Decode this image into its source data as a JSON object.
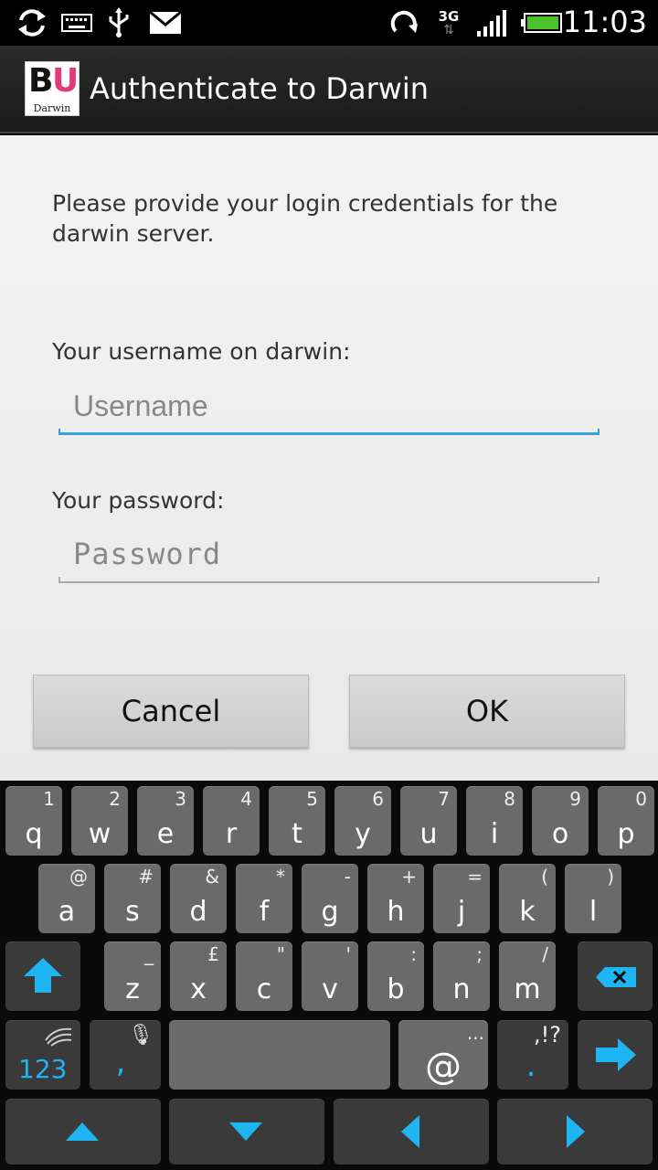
{
  "status_bar": {
    "time": "11:03",
    "network": "3G",
    "icons": [
      "sync-icon",
      "keyboard-icon",
      "usb-icon",
      "mail-icon",
      "refresh-icon",
      "network-3g-icon",
      "signal-icon",
      "battery-icon"
    ]
  },
  "action_bar": {
    "logo": {
      "letters_b": "B",
      "letters_u": "U",
      "caption": "Darwin"
    },
    "title": "Authenticate to Darwin"
  },
  "dialog": {
    "message": "Please provide your login credentials for the darwin server.",
    "username_label": "Your username on darwin:",
    "username_placeholder": "Username",
    "password_label": "Your password:",
    "password_placeholder": "Password",
    "cancel_label": "Cancel",
    "ok_label": "OK"
  },
  "keyboard": {
    "row1": [
      {
        "k": "q",
        "a": "1"
      },
      {
        "k": "w",
        "a": "2"
      },
      {
        "k": "e",
        "a": "3"
      },
      {
        "k": "r",
        "a": "4"
      },
      {
        "k": "t",
        "a": "5"
      },
      {
        "k": "y",
        "a": "6"
      },
      {
        "k": "u",
        "a": "7"
      },
      {
        "k": "i",
        "a": "8"
      },
      {
        "k": "o",
        "a": "9"
      },
      {
        "k": "p",
        "a": "0"
      }
    ],
    "row2": [
      {
        "k": "a",
        "a": "@"
      },
      {
        "k": "s",
        "a": "#"
      },
      {
        "k": "d",
        "a": "&"
      },
      {
        "k": "f",
        "a": "*"
      },
      {
        "k": "g",
        "a": "-"
      },
      {
        "k": "h",
        "a": "+"
      },
      {
        "k": "j",
        "a": "="
      },
      {
        "k": "k",
        "a": "("
      },
      {
        "k": "l",
        "a": ")"
      }
    ],
    "row3": [
      {
        "k": "z",
        "a": "_"
      },
      {
        "k": "x",
        "a": "£"
      },
      {
        "k": "c",
        "a": "\""
      },
      {
        "k": "v",
        "a": "'"
      },
      {
        "k": "b",
        "a": ":"
      },
      {
        "k": "n",
        "a": ";"
      },
      {
        "k": "m",
        "a": "/"
      }
    ],
    "numbers_label": "123",
    "comma_label": ",",
    "at_label": "@",
    "at_alt": "...",
    "punct_label": ".",
    "punct_alt": ",!?"
  },
  "colors": {
    "accent": "#33a2d6",
    "key_blue": "#1fb4f2"
  }
}
